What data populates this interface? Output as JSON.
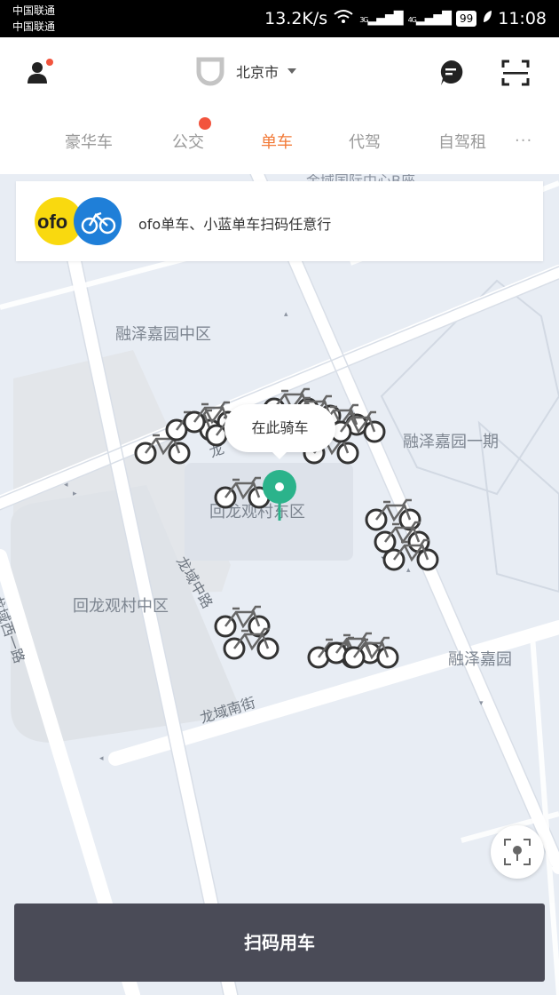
{
  "status_bar": {
    "carrier_1": "中国联通",
    "carrier_2": "中国联通",
    "speed": "13.2K/s",
    "net_3g": "3G",
    "net_4g": "4G",
    "battery": "99",
    "time": "11:08"
  },
  "header": {
    "city": "北京市"
  },
  "tabs": [
    {
      "label": "豪华车",
      "active": false
    },
    {
      "label": "公交",
      "active": false,
      "hot": true
    },
    {
      "label": "单车",
      "active": true
    },
    {
      "label": "代驾",
      "active": false
    },
    {
      "label": "自驾租",
      "active": false
    }
  ],
  "more_label": "···",
  "banner": {
    "logo_text": "ofo",
    "text": "ofo单车、小蓝单车扫码任意行"
  },
  "map": {
    "areas": [
      "融泽嘉园中区",
      "融泽嘉园一期",
      "回龙观村东区",
      "回龙观村中区",
      "融泽嘉园"
    ],
    "roads": [
      "龙域西一路",
      "龙域中路",
      "龙域南街",
      "路",
      "龙"
    ],
    "top_poi": "金域国际中心B座"
  },
  "pin_bubble": "在此骑车",
  "scan_button": "扫码用车",
  "colors": {
    "accent": "#f27b39",
    "pin": "#2bb38b",
    "button_bg": "#4a4b57",
    "hot": "#f2543d"
  }
}
